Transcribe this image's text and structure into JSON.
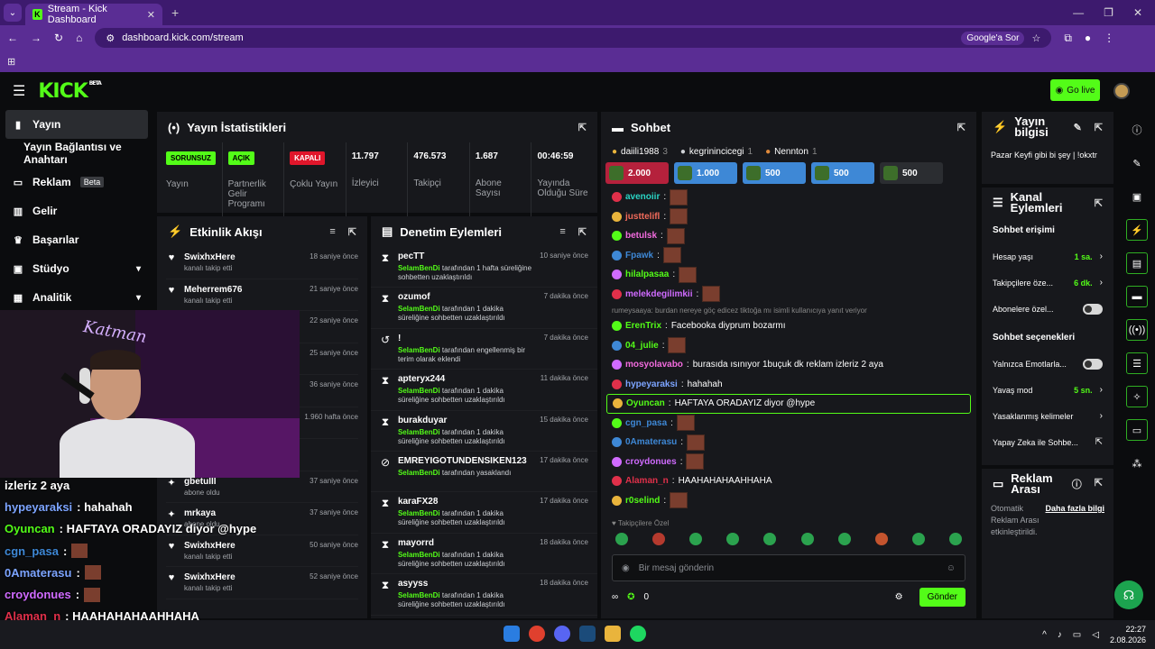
{
  "browser": {
    "tab_title": "Stream - Kick Dashboard",
    "url": "dashboard.kick.com/stream",
    "search_chip": "Google'a Sor"
  },
  "header": {
    "logo": "KICK",
    "logo_badge": "BETA",
    "go_live": "Go live"
  },
  "sidebar": {
    "items": [
      {
        "label": "Yayın"
      },
      {
        "label": "Yayın Bağlantısı ve Anahtarı"
      },
      {
        "label": "Reklam",
        "tag": "Beta"
      },
      {
        "label": "Gelir"
      },
      {
        "label": "Başarılar"
      },
      {
        "label": "Stüdyo"
      },
      {
        "label": "Analitik"
      }
    ]
  },
  "stats": {
    "title": "Yayın İstatistikleri",
    "cells": [
      {
        "value": "SORUNSUZ",
        "label": "Yayın"
      },
      {
        "value": "AÇIK",
        "label": "Partnerlik Gelir Programı"
      },
      {
        "value": "KAPALI",
        "label": "Çoklu Yayın"
      },
      {
        "value": "11.797",
        "label": "İzleyici"
      },
      {
        "value": "476.573",
        "label": "Takipçi"
      },
      {
        "value": "1.687",
        "label": "Abone Sayısı"
      },
      {
        "value": "00:46:59",
        "label": "Yayında Olduğu Süre"
      }
    ]
  },
  "activity": {
    "title": "Etkinlik Akışı",
    "items": [
      {
        "name": "SwixhxHere",
        "sub": "kanalı takip etti",
        "time": "18 saniye önce"
      },
      {
        "name": "Meherrem676",
        "sub": "kanalı takip etti",
        "time": "21 saniye önce"
      },
      {
        "name": "",
        "sub": "",
        "time": "22 saniye önce"
      },
      {
        "name": "",
        "sub": "",
        "time": "25 saniye önce"
      },
      {
        "name": "",
        "sub": "",
        "time": "36 saniye önce"
      },
      {
        "name": "",
        "sub": "",
        "time": "1.960 hafta önce"
      },
      {
        "name": "",
        "sub": "gönderdi",
        "time": ""
      },
      {
        "name": "gbetulll",
        "sub": "abone oldu",
        "time": "37 saniye önce"
      },
      {
        "name": "mrkaya",
        "sub": "abone oldu",
        "time": "37 saniye önce"
      },
      {
        "name": "SwixhxHere",
        "sub": "kanalı takip etti",
        "time": "50 saniye önce"
      },
      {
        "name": "SwixhxHere",
        "sub": "kanalı takip etti",
        "time": "52 saniye önce"
      }
    ]
  },
  "moderation": {
    "title": "Denetim Eylemleri",
    "items": [
      {
        "name": "pecTT",
        "mod": "SelamBenDi",
        "sub": "tarafından 1 hafta süreliğine sohbetten uzaklaştırıldı",
        "time": "10 saniye önce"
      },
      {
        "name": "ozumof",
        "mod": "SelamBenDi",
        "sub": "tarafından 1 dakika süreliğine sohbetten uzaklaştırıldı",
        "time": "7 dakika önce"
      },
      {
        "name": "!",
        "mod": "SelamBenDi",
        "sub": "tarafından engellenmiş bir terim olarak eklendi",
        "time": "7 dakika önce"
      },
      {
        "name": "apteryx244",
        "mod": "SelamBenDi",
        "sub": "tarafından 1 dakika süreliğine sohbetten uzaklaştırıldı",
        "time": "11 dakika önce"
      },
      {
        "name": "burakduyar",
        "mod": "SelamBenDi",
        "sub": "tarafından 1 dakika süreliğine sohbetten uzaklaştırıldı",
        "time": "15 dakika önce"
      },
      {
        "name": "EMREYIGOTUNDENSIKEN123",
        "mod": "SelamBenDi",
        "sub": "tarafından yasaklandı",
        "time": "17 dakika önce"
      },
      {
        "name": "karaFX28",
        "mod": "SelamBenDi",
        "sub": "tarafından 1 dakika süreliğine sohbetten uzaklaştırıldı",
        "time": "17 dakika önce"
      },
      {
        "name": "mayorrd",
        "mod": "SelamBenDi",
        "sub": "tarafından 1 dakika süreliğine sohbetten uzaklaştırıldı",
        "time": "18 dakika önce"
      },
      {
        "name": "asyyss",
        "mod": "SelamBenDi",
        "sub": "tarafından 1 dakika süreliğine sohbetten uzaklaştırıldı",
        "time": "18 dakika önce"
      }
    ]
  },
  "chat": {
    "title": "Sohbet",
    "pinned": [
      {
        "name": "daiili1988",
        "count": "3"
      },
      {
        "name": "kegrinincicegi",
        "count": "1"
      },
      {
        "name": "Nennton",
        "count": "1"
      }
    ],
    "gifts": [
      {
        "amount": "2.000",
        "color": "#b5213c"
      },
      {
        "amount": "1.000",
        "color": "#3e88d6"
      },
      {
        "amount": "500",
        "color": "#3e88d6"
      },
      {
        "amount": "500",
        "color": "#3e88d6"
      },
      {
        "amount": "500",
        "color": "#2b2d31"
      }
    ],
    "messages": [
      {
        "user": "avenoiir",
        "color": "#2ad4c4",
        "text": "",
        "emote": true
      },
      {
        "user": "justtelifl",
        "color": "#f26b5b",
        "text": "",
        "emote": true
      },
      {
        "user": "betulsk",
        "color": "#f26bde",
        "text": "",
        "emote": true
      },
      {
        "user": "Fpawk",
        "color": "#3e88d6",
        "text": "",
        "emote": true
      },
      {
        "user": "hilalpasaa",
        "color": "#53fc18",
        "text": "",
        "emote": true
      },
      {
        "user": "melekdegilimkii",
        "color": "#d06bff",
        "text": "",
        "emote": true
      },
      {
        "reply": "rumeysaaya: burdan nereye göç edicez tiktoğa mı isimli kullanıcıya yanıt veriyor"
      },
      {
        "user": "ErenTrix",
        "color": "#53fc18",
        "text": "Facebooka diyprum bozarmı",
        "emote": false
      },
      {
        "user": "04_julie",
        "color": "#53fc18",
        "text": "",
        "emote": true
      },
      {
        "user": "mosyolavabo",
        "color": "#f26bde",
        "text": "burasıda ısınıyor 1buçuk dk reklam izleriz 2 aya",
        "emote": false
      },
      {
        "user": "hypeyaraksi",
        "color": "#7ca4ff",
        "text": "hahahah",
        "emote": false
      },
      {
        "user": "Oyuncan",
        "color": "#53fc18",
        "text": "HAFTAYA ORADAYIZ diyor @hype",
        "emote": false,
        "highlight": true
      },
      {
        "user": "cgn_pasa",
        "color": "#3e88d6",
        "text": "",
        "emote": true
      },
      {
        "user": "0Amaterasu",
        "color": "#3e88d6",
        "text": "",
        "emote": true
      },
      {
        "user": "croydonues",
        "color": "#d06bff",
        "text": "",
        "emote": true
      },
      {
        "user": "Alaman_n",
        "color": "#e0304a",
        "text": "HAAHAHAHAAHHAHA",
        "emote": false
      },
      {
        "user": "r0selind",
        "color": "#53fc18",
        "text": "",
        "emote": true
      }
    ],
    "sub_only": "Takipçilere Özel",
    "input_placeholder": "Bir mesaj gönderin",
    "points": "0",
    "send": "Gönder"
  },
  "stream_info": {
    "title": "Yayın bilgisi",
    "text": "Pazar Keyfi gibi bi şey | !okxtr"
  },
  "chat_actions": {
    "title": "Kanal Eylemleri",
    "access_title": "Sohbet erişimi",
    "rows": [
      {
        "label": "Hesap yaşı",
        "value": "1 sa."
      },
      {
        "label": "Takipçilere öze...",
        "value": "6 dk."
      },
      {
        "label": "Abonelere özel..."
      }
    ],
    "options_title": "Sohbet seçenekleri",
    "opt_rows": [
      {
        "label": "Yalnızca Emotlarla..."
      },
      {
        "label": "Yavaş mod",
        "value": "5 sn."
      },
      {
        "label": "Yasaklanmış kelimeler"
      },
      {
        "label": "Yapay Zeka ile Sohbe..."
      }
    ]
  },
  "ad_break": {
    "title": "Reklam Arası",
    "text": "Otomatik Reklam Arası etkinleştirildi.",
    "link": "Daha fazla bilgi"
  },
  "overlay": {
    "brand": "Katman",
    "messages": [
      {
        "user": "",
        "text": "izleriz 2 aya",
        "color": "#ffffff"
      },
      {
        "user": "hypeyaraksi",
        "text": ": hahahah",
        "color": "#7ca4ff"
      },
      {
        "user": "Oyuncan",
        "text": ": HAFTAYA ORADAYIZ diyor @hype",
        "color": "#53fc18"
      },
      {
        "user": "cgn_pasa",
        "text": ":",
        "color": "#3e88d6"
      },
      {
        "user": "0Amaterasu",
        "text": ":",
        "color": "#7ca4ff"
      },
      {
        "user": "croydonues",
        "text": ":",
        "color": "#d06bff"
      },
      {
        "user": "Alaman_n",
        "text": ": HAAHAHAHAAHHAHA",
        "color": "#e0304a"
      },
      {
        "user": "r0selind",
        "text": ":",
        "color": "#ffffff"
      }
    ]
  },
  "taskbar": {
    "time": "22:27",
    "date": "2.08.2026"
  }
}
